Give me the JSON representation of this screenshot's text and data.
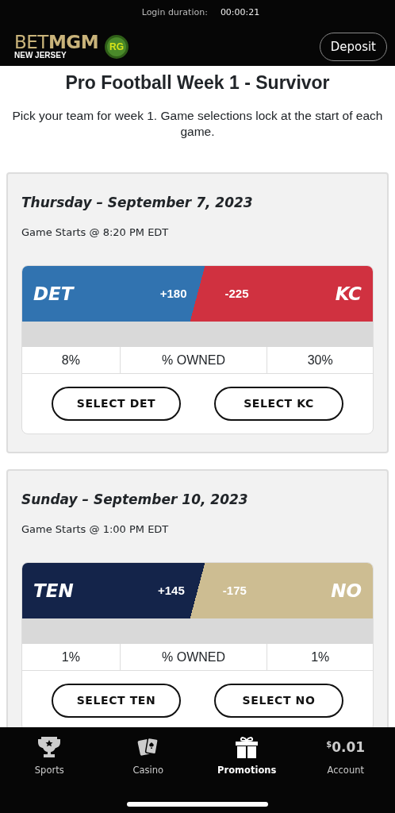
{
  "header": {
    "login_label": "Login duration:",
    "login_time": "00:00:21",
    "logo_text_light": "BET",
    "logo_text_bold": "MGM",
    "logo_region": "NEW JERSEY",
    "rg_badge": "RG",
    "deposit_button": "Deposit"
  },
  "title": "Pro Football Week 1 - Survivor",
  "subtitle": "Pick your team for week 1. Game selections lock at the start of each game.",
  "games": [
    {
      "date": "Thursday – September 7, 2023",
      "start": "Game Starts @ 8:20 PM EDT",
      "away": {
        "abbr": "DET",
        "odds": "+180",
        "color": "#3173b0",
        "pct": "8%",
        "button": "SELECT DET"
      },
      "home": {
        "abbr": "KC",
        "odds": "-225",
        "color": "#d03140",
        "pct": "30%",
        "button": "SELECT KC"
      },
      "owned_label": "% OWNED"
    },
    {
      "date": "Sunday – September 10, 2023",
      "start": "Game Starts @ 1:00 PM EDT",
      "away": {
        "abbr": "TEN",
        "odds": "+145",
        "color": "#14244a",
        "pct": "1%",
        "button": "SELECT TEN"
      },
      "home": {
        "abbr": "NO",
        "odds": "-175",
        "color": "#cdbd92",
        "pct": "1%",
        "button": "SELECT NO"
      },
      "owned_label": "% OWNED"
    }
  ],
  "bottom_nav": [
    {
      "kind": "trophy",
      "label": "Sports",
      "selected": false
    },
    {
      "kind": "cards",
      "label": "Casino",
      "selected": false
    },
    {
      "kind": "gift",
      "label": "Promotions",
      "selected": true
    },
    {
      "kind": "balance",
      "currency": "$",
      "amount": "0.01",
      "label": "Account",
      "selected": false
    }
  ]
}
